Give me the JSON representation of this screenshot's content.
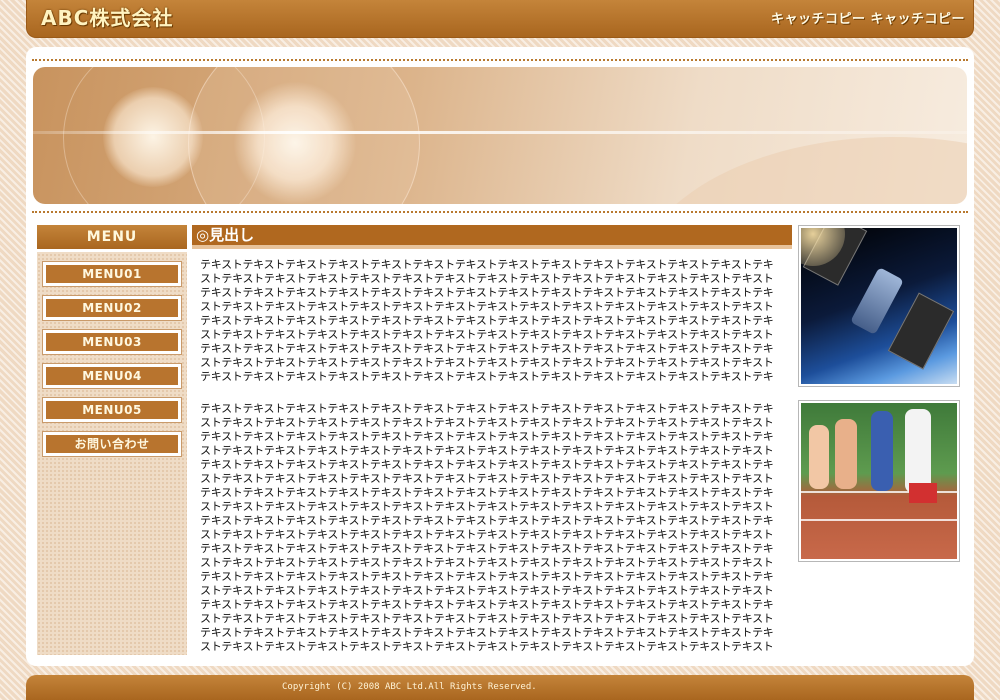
{
  "header": {
    "logo": "ABC株式会社",
    "catch_copy": "キャッチコピー キャッチコピー"
  },
  "sidebar": {
    "menu_title": "MENU",
    "items": [
      {
        "label": "MENU01"
      },
      {
        "label": "MENU02"
      },
      {
        "label": "MENU03"
      },
      {
        "label": "MENU04"
      },
      {
        "label": "MENU05"
      },
      {
        "label": "お問い合わせ"
      }
    ]
  },
  "main": {
    "heading": "◎見出し",
    "paragraph1": "テキストテキストテキストテキストテキストテキストテキストテキストテキストテキストテキストテキストテキストテキストテキストテキストテキストテキストテキストテキストテキストテキストテキストテキストテキストテキストテキストテキストテキストテキストテキストテキストテキストテキストテキストテキストテキストテキストテキストテキストテキストテキストテキストテキストテキストテキストテキストテキストテキストテキストテキストテキストテキストテキストテキストテキストテキストテキストテキストテキストテキストテキストテキストテキストテキストテキストテキストテキストテキストテキストテキストテキストテキストテキストテキストテキストテキストテキストテキストテキストテキストテキストテキストテキストテキストテキストテキストテキストテキストテキストテキストテキストテキストテキストテキストテキストテキストテキストテキストテキストテキストテキストテキストテキストテキストテキストテキストテキストテキストテキストテキストテキストテキストテキストテキストテキストテキストテキストテキストテキストテキストテキストテキストテキストテキストテキストテキストテキストテキストテキストテキストテキストテキストテキストテキストテキストテキストテキストテキストテキストテキストテキストテキストテキストテキストテキストテキストテキストテキストテキストテキストテキストテキストテキストテキストテキストテキストテキストテキストテキストテキストテキストテキストテキストテキストテキストテキストテキストテキスト",
    "paragraph2": "テキストテキストテキストテキストテキストテキストテキストテキストテキストテキストテキストテキストテキストテキストテキストテキストテキストテキストテキストテキストテキストテキストテキストテキストテキストテキストテキストテキストテキストテキストテキストテキストテキストテキストテキストテキストテキストテキストテキストテキストテキストテキストテキストテキストテキストテキストテキストテキストテキストテキストテキストテキストテキストテキストテキストテキストテキストテキストテキストテキストテキストテキストテキストテキストテキストテキストテキストテキストテキストテキストテキストテキストテキストテキストテキストテキストテキストテキストテキストテキストテキストテキストテキストテキストテキストテキストテキストテキストテキストテキストテキストテキストテキストテキストテキストテキストテキストテキストテキストテキストテキストテキストテキストテキストテキストテキストテキストテキストテキストテキストテキストテキストテキストテキストテキストテキストテキストテキストテキストテキストテキストテキストテキストテキストテキストテキストテキストテキストテキストテキストテキストテキストテキストテキストテキストテキストテキストテキストテキストテキストテキストテキストテキストテキストテキストテキストテキストテキストテキストテキストテキストテキストテキストテキストテキストテキストテキストテキストテキストテキストテキストテキストテキストテキストテキストテキストテキストテキストテキストテキストテキストテキストテキストテキストテキストテキストテキストテキストテキストテキストテキストテキストテキストテキストテキストテキストテキストテキストテキストテキストテキストテキストテキストテキストテキストテキストテキストテキストテキストテキストテキストテキストテキストテキストテキストテキストテキストテキストテキストテキストテキストテキストテキストテキストテキストテキストテキストテキストテキストテキストテキストテキストテキストテキストテキストテキストテキストテキストテキストテキストテキストテキストテキストテキストテキストテキストテキストテキストテキストテキストテキストテキストテキストテキストテキストテキストテキストテキストテキストテキストテキストテキストテキストテキストテキストテキストテキストテキストテキストテキストテキストテキストテキストテキストテキストテキストテキストテキストテキストテキストテキストテキストテキストテキストテキストテキストテキストテキストテキストテキストテキストテキストテキストテキストテキストテキストテキストテキストテキストテキストテキストテキスト"
  },
  "footer": {
    "copyright": "Copyright (C) 2008 ABC Ltd.All Rights Reserved."
  },
  "colors": {
    "brand_brown": "#b0681f",
    "background": "#efd9c2"
  }
}
